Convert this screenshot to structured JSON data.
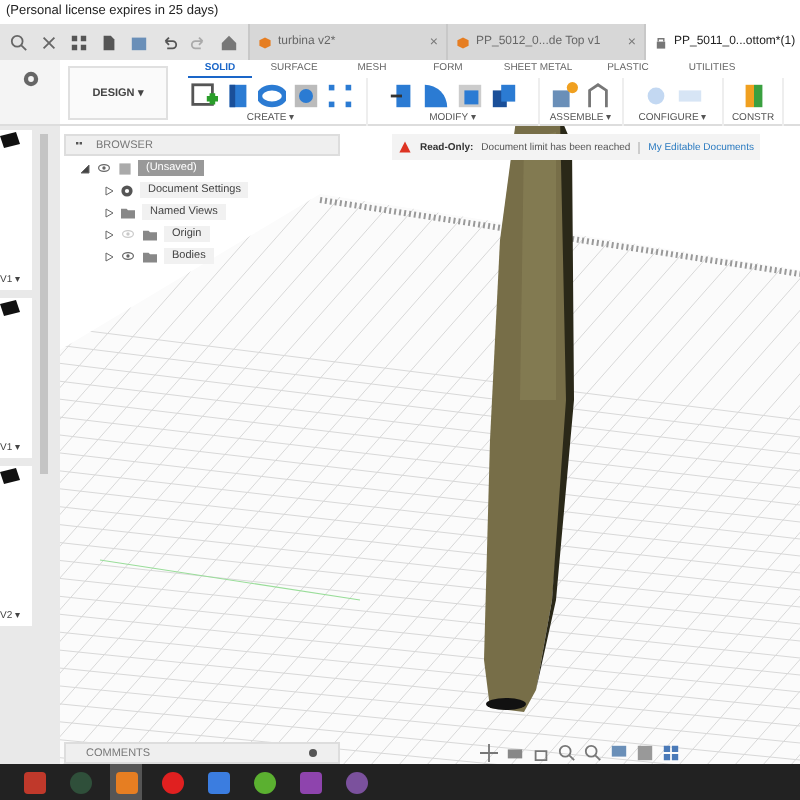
{
  "license_notice": "(Personal license expires in 25 days)",
  "document_tabs": [
    {
      "label": "turbina v2*",
      "close": "×",
      "locked": false,
      "selected": false
    },
    {
      "label": "PP_5012_0...de Top v1",
      "close": "×",
      "locked": false,
      "selected": false
    },
    {
      "label": "PP_5011_0...ottom*(1)",
      "locked": true,
      "selected": true
    }
  ],
  "workspace_button": "DESIGN ▾",
  "toolbar_tabs": [
    {
      "label": "SOLID",
      "selected": true
    },
    {
      "label": "SURFACE",
      "selected": false
    },
    {
      "label": "MESH",
      "selected": false
    },
    {
      "label": "FORM",
      "selected": false
    },
    {
      "label": "SHEET METAL",
      "selected": false
    },
    {
      "label": "PLASTIC",
      "selected": false
    },
    {
      "label": "UTILITIES",
      "selected": false
    }
  ],
  "tool_groups": [
    {
      "label": "CREATE ▾",
      "disabled": false
    },
    {
      "label": "MODIFY ▾",
      "disabled": false
    },
    {
      "label": "ASSEMBLE ▾",
      "disabled": false
    },
    {
      "label": "CONFIGURE ▾",
      "disabled": true
    },
    {
      "label": "CONSTR",
      "disabled": false
    }
  ],
  "data_panel": {
    "versions": [
      "V1 ▾",
      "V1 ▾",
      "V2 ▾"
    ]
  },
  "browser": {
    "title": "BROWSER",
    "tree": [
      {
        "label": "(Unsaved)",
        "kind": "component",
        "visible": true,
        "expanded": true,
        "selected": true,
        "children": [
          {
            "label": "Document Settings",
            "kind": "settings",
            "expanded": false,
            "selected": false
          },
          {
            "label": "Named Views",
            "kind": "folder",
            "expanded": false,
            "selected": false
          },
          {
            "label": "Origin",
            "kind": "folder",
            "visible": false,
            "expanded": false,
            "selected": false
          },
          {
            "label": "Bodies",
            "kind": "folder",
            "visible": true,
            "expanded": false,
            "selected": false
          }
        ]
      }
    ]
  },
  "banner": {
    "title": "Read-Only:",
    "message": "Document limit has been reached",
    "link": "My Editable Documents"
  },
  "comments": {
    "title": "COMMENTS"
  },
  "taskbar": {
    "apps": [
      {
        "color": "#c0392b",
        "selected": false
      },
      {
        "color": "#2f4f3a",
        "selected": false
      },
      {
        "color": "#e67e22",
        "selected": true
      },
      {
        "color": "#e02020",
        "selected": false
      },
      {
        "color": "#3b7de0",
        "selected": false
      },
      {
        "color": "#5bb030",
        "selected": false
      },
      {
        "color": "#8e44ad",
        "selected": false
      },
      {
        "color": "#7b519d",
        "selected": false
      }
    ]
  }
}
